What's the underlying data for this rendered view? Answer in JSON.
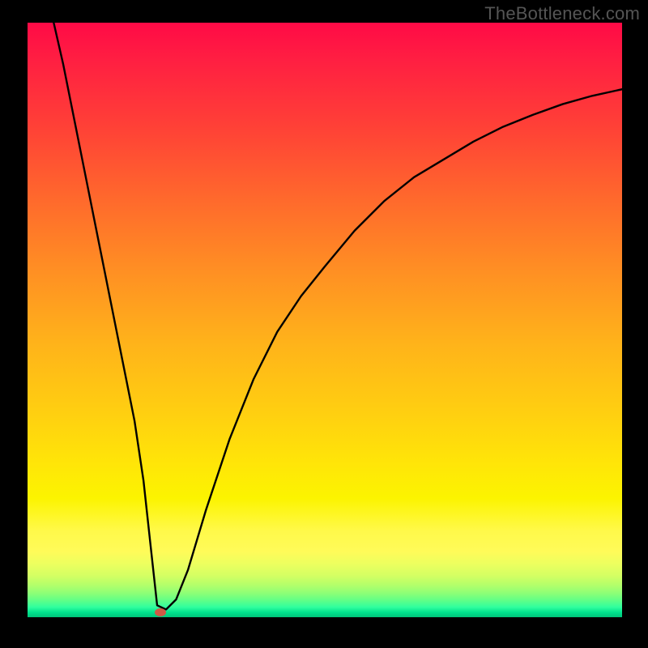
{
  "watermark": "TheBottleneck.com",
  "colors": {
    "page_bg": "#000000",
    "curve": "#000000",
    "marker": "#cf5a46"
  },
  "chart_data": {
    "type": "line",
    "title": "",
    "xlabel": "",
    "ylabel": "",
    "xlim": [
      0,
      100
    ],
    "ylim": [
      0,
      100
    ],
    "grid": false,
    "legend": false,
    "series": [
      {
        "name": "curve",
        "x": [
          4.4,
          6,
          8,
          10,
          12,
          14,
          16,
          18,
          19.5,
          20.7,
          21.8,
          23.3,
          25,
          27,
          30,
          34,
          38,
          42,
          46,
          50,
          55,
          60,
          65,
          70,
          75,
          80,
          85,
          90,
          95,
          100
        ],
        "y": [
          100,
          93,
          83,
          73,
          63,
          53,
          43,
          33,
          23,
          12,
          2,
          1.3,
          3,
          8,
          18,
          30,
          40,
          48,
          54,
          59,
          65,
          70,
          74,
          77,
          80,
          82.5,
          84.5,
          86.3,
          87.7,
          88.8
        ]
      }
    ],
    "marker": {
      "x": 22.3,
      "y": 0.8
    }
  }
}
